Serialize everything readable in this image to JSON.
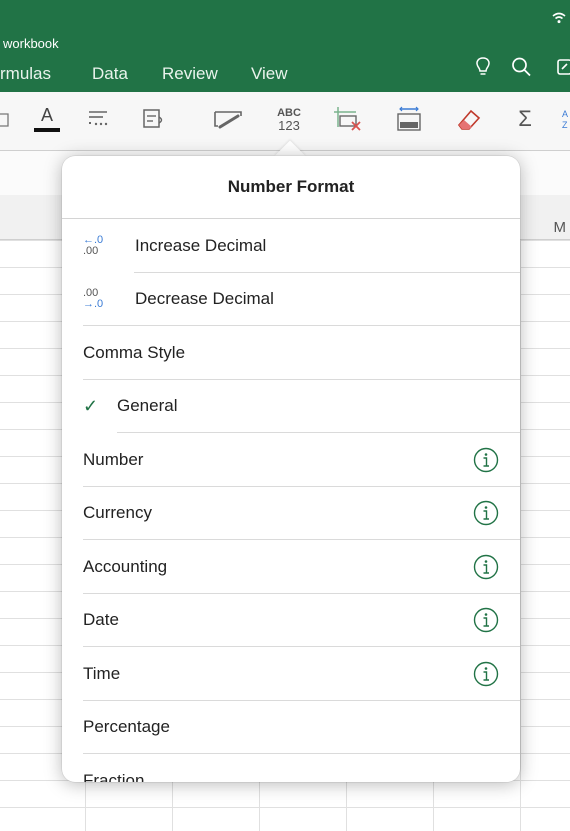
{
  "header": {
    "title": "workbook",
    "tabs": [
      "rmulas",
      "Data",
      "Review",
      "View"
    ]
  },
  "sheet": {
    "column_letter": "M"
  },
  "popover": {
    "title": "Number Format",
    "items": [
      {
        "label": "Increase Decimal",
        "icon_top": "←.0",
        "icon_bottom": ".00"
      },
      {
        "label": "Decrease Decimal",
        "icon_top": ".00",
        "icon_bottom": "→.0"
      },
      {
        "label": "Comma Style"
      },
      {
        "label": "General",
        "checked": true
      },
      {
        "label": "Number"
      },
      {
        "label": "Currency"
      },
      {
        "label": "Accounting"
      },
      {
        "label": "Date"
      },
      {
        "label": "Time"
      },
      {
        "label": "Percentage"
      },
      {
        "label": "Fraction"
      }
    ]
  },
  "toolbar": {
    "font_color_letter": "A",
    "text_format_top": "ABC",
    "text_format_bottom": "123",
    "sum_symbol": "Σ"
  },
  "colors": {
    "ribbon": "#217346",
    "accent": "#217346"
  }
}
